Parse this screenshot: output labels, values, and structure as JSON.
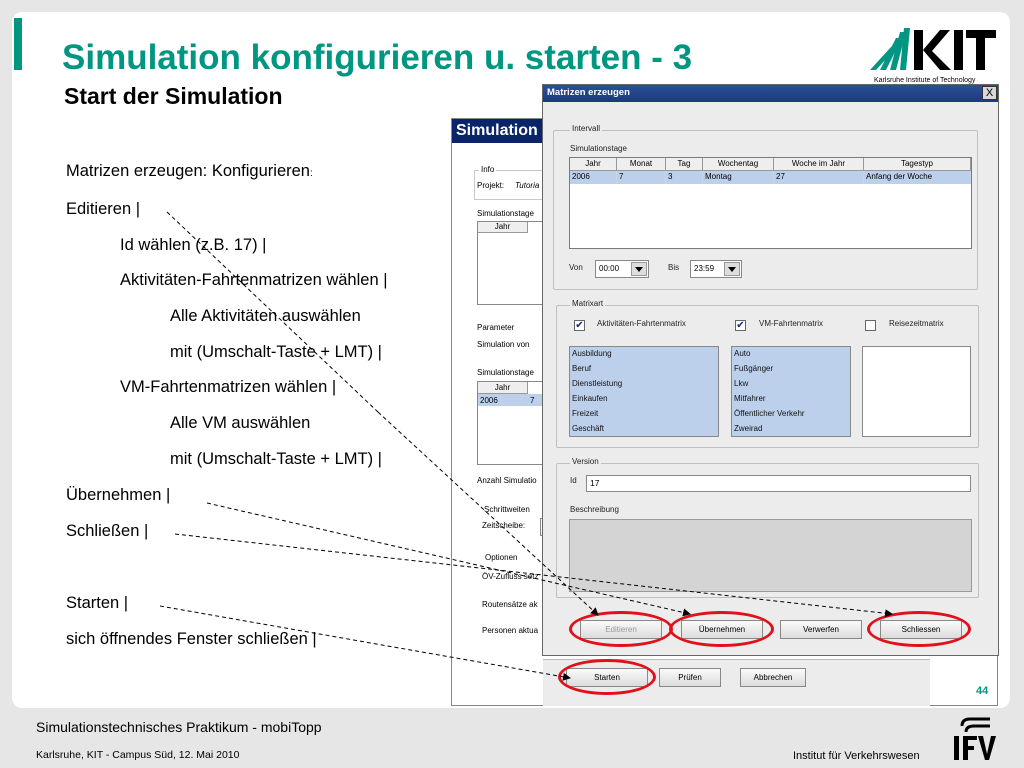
{
  "slide": {
    "title": "Simulation konfigurieren u. starten - 3",
    "subtitle": "Start der Simulation",
    "logo_sub": "Karlsruhe Institute of Technology",
    "page_number": "44",
    "footer_main": "Simulationstechnisches Praktikum - mobiTopp",
    "footer_sub": "Karlsruhe, KIT - Campus Süd, 12. Mai  2010",
    "footer_institute": "Institut für Verkehrswesen"
  },
  "steps": [
    "Matrizen erzeugen: Konfigurieren",
    "Editieren |",
    "Id wählen (z.B. 17) |",
    "Aktivitäten-Fahrtenmatrizen wählen |",
    "Alle Aktivitäten auswählen",
    "mit (Umschalt-Taste + LMT) |",
    "VM-Fahrtenmatrizen wählen |",
    "Alle VM auswählen",
    "mit (Umschalt-Taste + LMT) |",
    "Übernehmen |",
    "Schließen |",
    "Starten |",
    "sich öffnendes Fenster schließen |"
  ],
  "step0_suffix": ":",
  "background_window": {
    "title": "Simulation",
    "info_label": "Info",
    "projekt_label": "Projekt:",
    "projekt_value": "Tutoria",
    "simtage_label": "Simulationstage",
    "col_jahr": "Jahr",
    "parameter_label": "Parameter",
    "sim_von": "Simulation von",
    "simtage2_label": "Simulationstage",
    "col_jahr2": "Jahr",
    "row_year": "2006",
    "row_month": "7",
    "anzahl": "Anzahl Simulatio",
    "schrittweiten": "Schrittweiten",
    "zeitscheibe": "Zeitscheibe:",
    "optionen": "Optionen",
    "oev": "ÖV-Zufluss setz",
    "routen": "Routensätze ak",
    "personen": "Personen aktua",
    "buttons": {
      "start": "Starten",
      "check": "Prüfen",
      "cancel": "Abbrechen"
    }
  },
  "dialog": {
    "title": "Matrizen erzeugen",
    "close_glyph": "X",
    "intervall": {
      "label": "Intervall",
      "simtage_label": "Simulationstage",
      "columns": [
        "Jahr",
        "Monat",
        "Tag",
        "Wochentag",
        "Woche im Jahr",
        "Tagestyp"
      ],
      "row": [
        "2006",
        "7",
        "3",
        "Montag",
        "27",
        "Anfang der Woche"
      ],
      "von_label": "Von",
      "von_value": "00:00",
      "bis_label": "Bis",
      "bis_value": "23:59"
    },
    "matrixart": {
      "label": "Matrixart",
      "check1_label": "Aktivitäten-Fahrtenmatrix",
      "check2_label": "VM-Fahrtenmatrix",
      "check3_label": "Reisezeitmatrix",
      "check_mark": "✔",
      "activities": [
        "Ausbildung",
        "Beruf",
        "Dienstleistung",
        "Einkaufen",
        "Freizeit",
        "Geschäft"
      ],
      "vm": [
        "Auto",
        "Fußgänger",
        "Lkw",
        "Mitfahrer",
        "Öffentlicher Verkehr",
        "Zweirad"
      ]
    },
    "version": {
      "label": "Version",
      "id_label": "Id",
      "id_value": "17",
      "beschreibung_label": "Beschreibung"
    },
    "buttons": {
      "edit": "Editieren",
      "apply": "Übernehmen",
      "discard": "Verwerfen",
      "close": "Schliessen"
    }
  }
}
